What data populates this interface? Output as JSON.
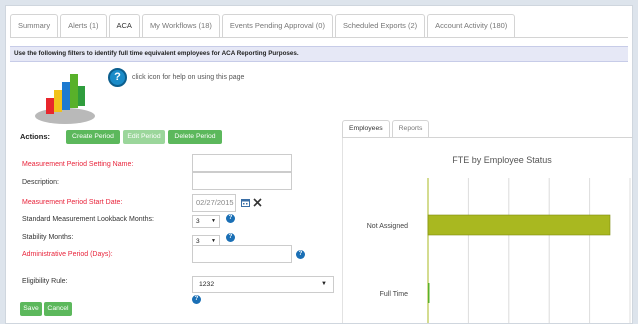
{
  "tabs": [
    {
      "label": "Summary",
      "active": false
    },
    {
      "label": "Alerts (1)",
      "active": false
    },
    {
      "label": "ACA",
      "active": true
    },
    {
      "label": "My Workflows (18)",
      "active": false
    },
    {
      "label": "Events Pending Approval (0)",
      "active": false
    },
    {
      "label": "Scheduled Exports (2)",
      "active": false
    },
    {
      "label": "Account Activity (180)",
      "active": false
    }
  ],
  "filter_bar": "Use the following filters to identify full time equivalent employees for ACA Reporting Purposes.",
  "help": {
    "icon": "?",
    "text": "click icon for help on using this page"
  },
  "actions": {
    "label": "Actions:",
    "create": "Create Period",
    "edit": "Edit Period",
    "delete": "Delete Period"
  },
  "form": {
    "measurement_period_name": {
      "label": "Measurement Period Setting Name:",
      "value": ""
    },
    "description": {
      "label": "Description:",
      "value": ""
    },
    "start_date": {
      "label": "Measurement Period Start Date:",
      "value": "02/27/2015"
    },
    "lookback": {
      "label": "Standard Measurement Lookback Months:",
      "value": "3"
    },
    "stability": {
      "label": "Stability Months:",
      "value": "3"
    },
    "admin_period": {
      "label": "Administrative Period (Days):",
      "value": ""
    },
    "eligibility": {
      "label": "Eligibility Rule:",
      "value": "1232"
    },
    "save": "Save",
    "cancel": "Cancel"
  },
  "right_panel": {
    "tabs": [
      {
        "label": "Employees",
        "active": true
      },
      {
        "label": "Reports",
        "active": false
      }
    ]
  },
  "colors": {
    "accent_green": "#5cb85c",
    "required_red": "#e8243b",
    "bar_color": "#a9b820",
    "help_blue": "#1a8bc8"
  },
  "chart_data": {
    "type": "bar",
    "orientation": "horizontal",
    "title": "FTE by Employee Status",
    "categories": [
      "Not Assigned",
      "Full Time"
    ],
    "values": [
      1,
      0
    ],
    "xlim": [
      0,
      1
    ],
    "grid": true,
    "legend": "none"
  }
}
